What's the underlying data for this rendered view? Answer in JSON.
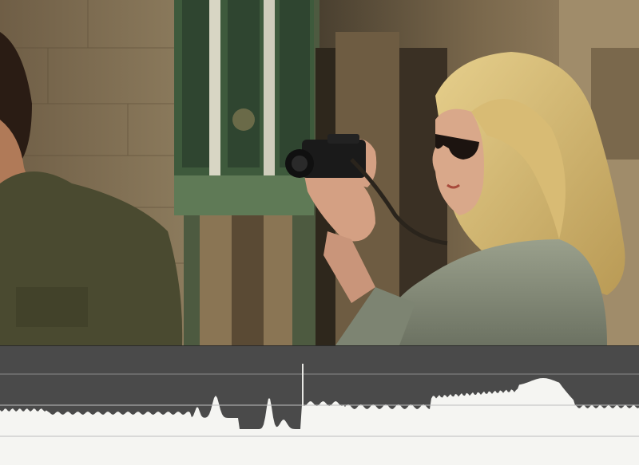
{
  "video_frame": {
    "description_icon": "video-frame-image"
  },
  "waveform": {
    "icon": "luminance-waveform",
    "trace_color": "#f5f5f2",
    "background_color": "#4a4a4a",
    "gridline_color": "#bdbdbd"
  }
}
